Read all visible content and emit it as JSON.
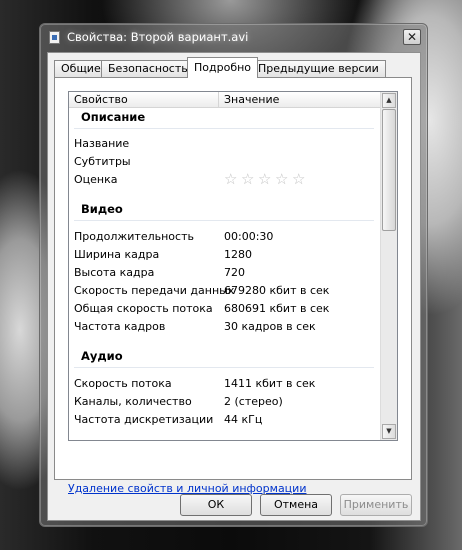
{
  "window": {
    "title": "Свойства: Второй вариант.avi"
  },
  "tabs": [
    "Общие",
    "Безопасность",
    "Подробно",
    "Предыдущие версии"
  ],
  "columns": {
    "property": "Свойство",
    "value": "Значение"
  },
  "groups": [
    {
      "title": "Описание",
      "rows": [
        {
          "k": "Название",
          "v": ""
        },
        {
          "k": "Субтитры",
          "v": ""
        },
        {
          "k": "Оценка",
          "v": "",
          "rating": 0,
          "rating_max": 5
        }
      ]
    },
    {
      "title": "Видео",
      "rows": [
        {
          "k": "Продолжительность",
          "v": "00:00:30"
        },
        {
          "k": "Ширина кадра",
          "v": "1280"
        },
        {
          "k": "Высота кадра",
          "v": "720"
        },
        {
          "k": "Скорость передачи данных",
          "v": "679280 кбит в сек"
        },
        {
          "k": "Общая скорость потока",
          "v": "680691 кбит в сек"
        },
        {
          "k": "Частота кадров",
          "v": "30 кадров в сек"
        }
      ]
    },
    {
      "title": "Аудио",
      "rows": [
        {
          "k": "Скорость потока",
          "v": "1411 кбит в сек"
        },
        {
          "k": "Каналы, количество",
          "v": "2 (стерео)"
        },
        {
          "k": "Частота дискретизации",
          "v": "44 кГц"
        }
      ]
    }
  ],
  "remove_link": "Удаление свойств и личной информации",
  "buttons": {
    "ok": "ОК",
    "cancel": "Отмена",
    "apply": "Применить"
  }
}
